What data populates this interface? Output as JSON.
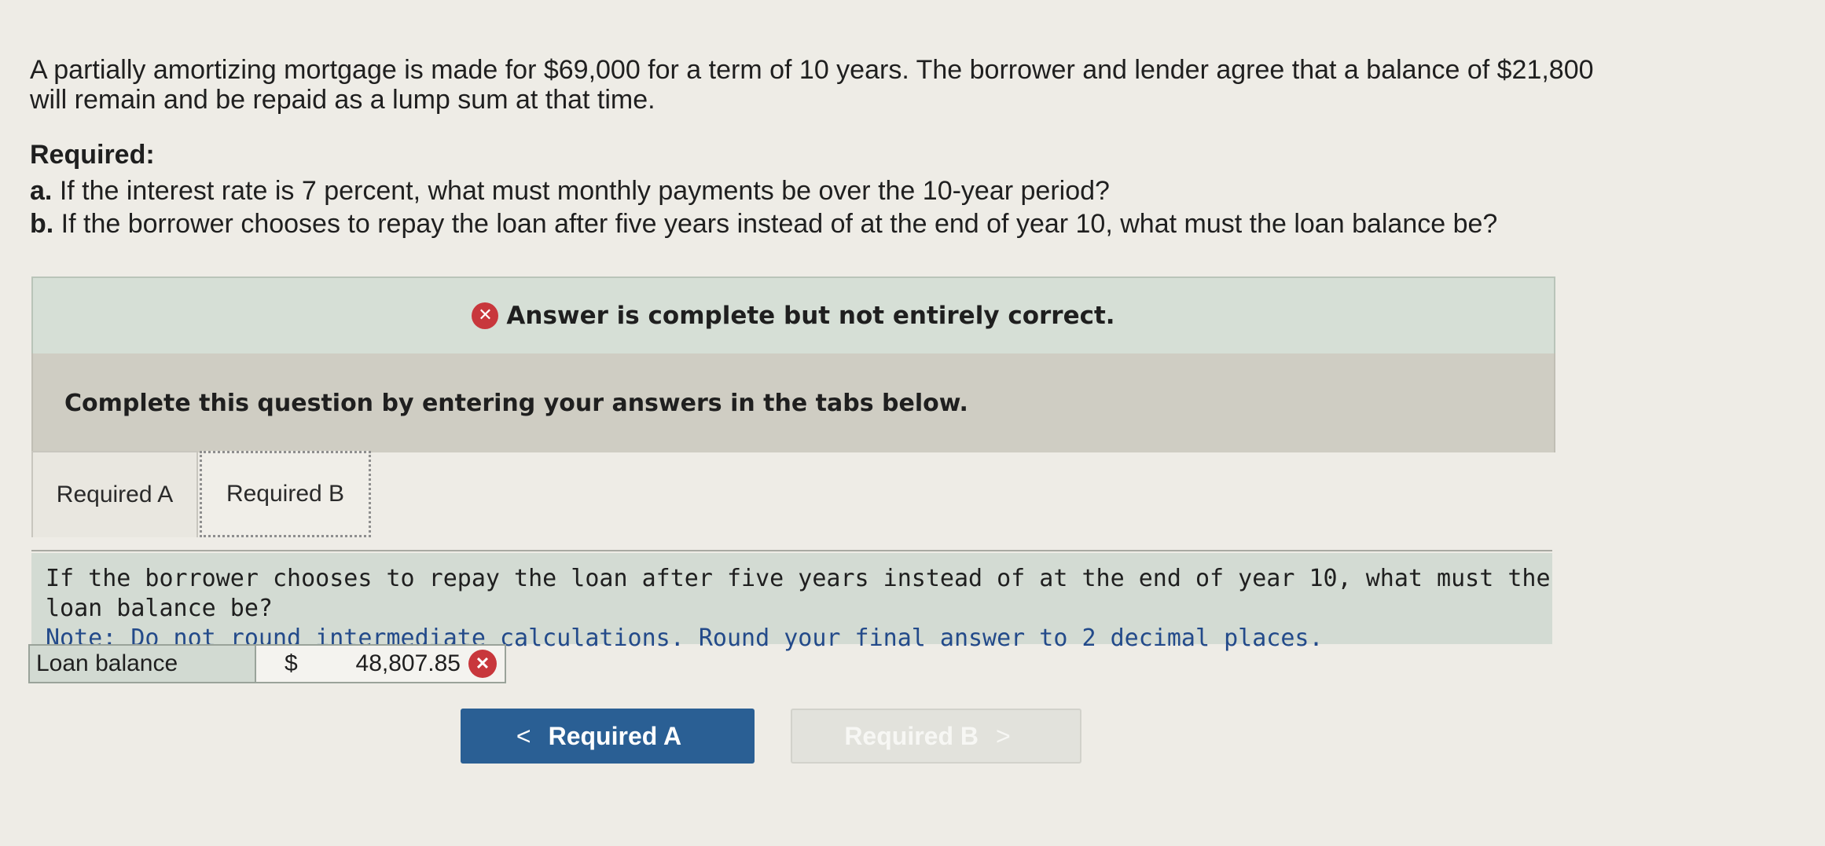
{
  "problem": {
    "line1": "A partially amortizing mortgage is made for $69,000 for a term of 10 years. The borrower and lender agree that a balance of $21,800",
    "line2": "will remain and be repaid as a lump sum at that time."
  },
  "required": {
    "title": "Required:",
    "a_prefix": "a.",
    "a_text": "If the interest rate is 7 percent, what must monthly payments be over the 10-year period?",
    "b_prefix": "b.",
    "b_text": "If the borrower chooses to repay the loan after five years instead of at the end of year 10, what must the loan balance be?"
  },
  "status": {
    "icon": "x-circle-icon",
    "message": "Answer is complete but not entirely correct."
  },
  "instructions": {
    "text": "Complete this question by entering your answers in the tabs below."
  },
  "tabs": [
    {
      "label": "Required A"
    },
    {
      "label": "Required B"
    }
  ],
  "question": {
    "text": "If the borrower chooses to repay the loan after five years instead of at the end of year 10, what must the loan balance be?",
    "note": "Note: Do not round intermediate calculations. Round your final answer to 2 decimal places."
  },
  "answer": {
    "label": "Loan balance",
    "currency": "$",
    "value": "48,807.85",
    "status_icon": "x-circle-icon"
  },
  "nav": {
    "prev_label": "Required A",
    "prev_chevron": "<",
    "next_label": "Required B",
    "next_chevron": ">"
  },
  "colors": {
    "error": "#c8373c",
    "primary_button": "#2a5f94"
  }
}
